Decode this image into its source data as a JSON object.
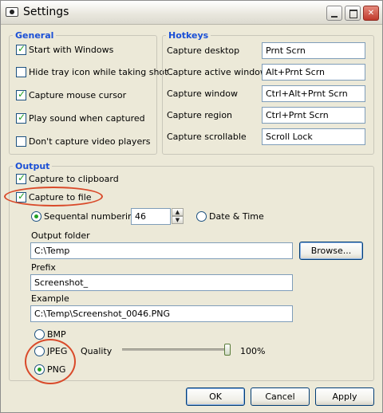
{
  "window": {
    "title": "Settings"
  },
  "general": {
    "legend": "General",
    "items": [
      {
        "label": "Start with Windows",
        "checked": true
      },
      {
        "label": "Hide tray icon while taking shot",
        "checked": false
      },
      {
        "label": "Capture mouse cursor",
        "checked": true
      },
      {
        "label": "Play sound when captured",
        "checked": true
      },
      {
        "label": "Don't capture video players",
        "checked": false
      }
    ]
  },
  "hotkeys": {
    "legend": "Hotkeys",
    "rows": [
      {
        "label": "Capture desktop",
        "value": "Prnt Scrn"
      },
      {
        "label": "Capture active window",
        "value": "Alt+Prnt Scrn"
      },
      {
        "label": "Capture window",
        "value": "Ctrl+Alt+Prnt Scrn"
      },
      {
        "label": "Capture region",
        "value": "Ctrl+Prnt Scrn"
      },
      {
        "label": "Capture scrollable",
        "value": "Scroll Lock"
      }
    ]
  },
  "output": {
    "legend": "Output",
    "clipboard_label": "Capture to clipboard",
    "clipboard_checked": true,
    "file_label": "Capture to file",
    "file_checked": true,
    "naming": {
      "sequential_label": "Sequental numbering",
      "sequential_value": "46",
      "datetime_label": "Date & Time",
      "selected": "sequential"
    },
    "folder": {
      "label": "Output folder",
      "value": "C:\\Temp",
      "browse_label": "Browse..."
    },
    "prefix": {
      "label": "Prefix",
      "value": "Screenshot_"
    },
    "example": {
      "label": "Example",
      "value": "C:\\Temp\\Screenshot_0046.PNG"
    },
    "formats": {
      "bmp_label": "BMP",
      "jpeg_label": "JPEG",
      "png_label": "PNG",
      "selected": "PNG",
      "quality_label": "Quality",
      "quality_value": "100%",
      "quality_level": 1.0
    }
  },
  "buttons": {
    "ok": "OK",
    "cancel": "Cancel",
    "apply": "Apply"
  },
  "colors": {
    "legend": "#1a4fd6",
    "annotation": "#d94a2a",
    "check": "#21a121"
  }
}
